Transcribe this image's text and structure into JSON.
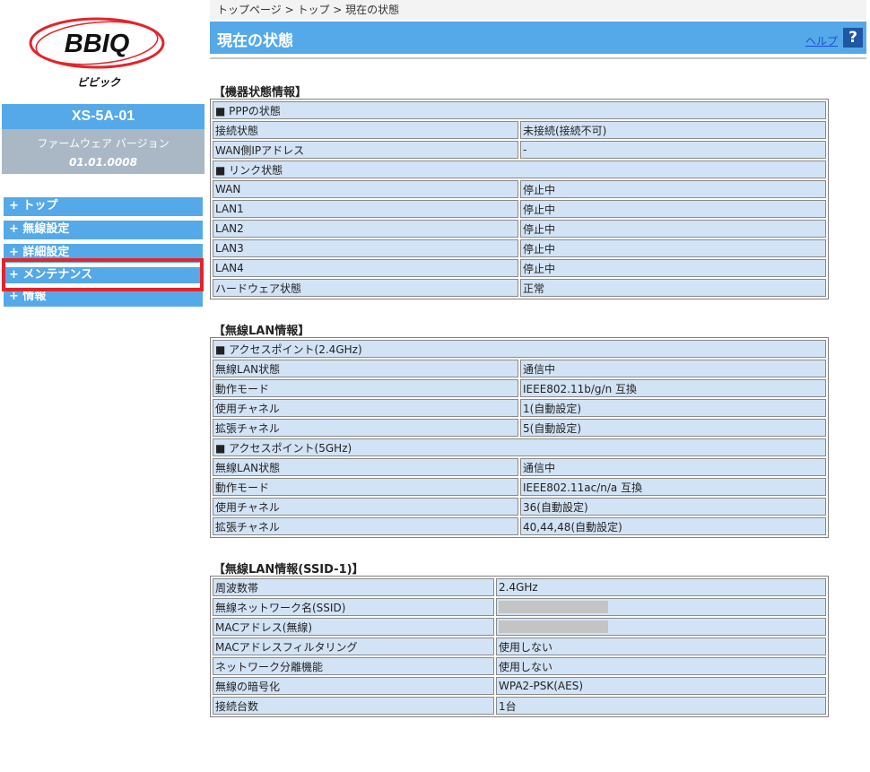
{
  "brand": {
    "logo_text": "BBIQ",
    "logo_sub": "ビビック",
    "logo_color": "#e3242b"
  },
  "device": {
    "model": "XS-5A-01",
    "firmware_label": "ファームウェア バージョン",
    "firmware_version": "01.01.0008"
  },
  "nav": {
    "items": [
      {
        "label": "+ トップ"
      },
      {
        "label": "+ 無線設定"
      },
      {
        "label": "+ 詳細設定"
      },
      {
        "label": "+ メンテナンス"
      },
      {
        "label": "+ 情報"
      }
    ]
  },
  "breadcrumb": "トップページ > トップ > 現在の状態",
  "header": {
    "title": "現在の状態",
    "help_label": "ヘルプ",
    "help_icon": "?"
  },
  "sections": [
    {
      "title": "【機器状態情報】",
      "rows": [
        {
          "type": "group",
          "label": "■ PPPの状態"
        },
        {
          "label": "接続状態",
          "value": "未接続(接続不可)"
        },
        {
          "label": "WAN側IPアドレス",
          "value": "-"
        },
        {
          "type": "group",
          "label": "■ リンク状態"
        },
        {
          "label": "WAN",
          "value": "停止中"
        },
        {
          "label": "LAN1",
          "value": "停止中"
        },
        {
          "label": "LAN2",
          "value": "停止中"
        },
        {
          "label": "LAN3",
          "value": "停止中"
        },
        {
          "label": "LAN4",
          "value": "停止中"
        },
        {
          "label": "ハードウェア状態",
          "value": "正常"
        }
      ]
    },
    {
      "title": "【無線LAN情報】",
      "rows": [
        {
          "type": "group",
          "label": "■ アクセスポイント(2.4GHz)"
        },
        {
          "label": "無線LAN状態",
          "value": "通信中"
        },
        {
          "label": "動作モード",
          "value": "IEEE802.11b/g/n 互換"
        },
        {
          "label": "使用チャネル",
          "value": "1(自動設定)"
        },
        {
          "label": "拡張チャネル",
          "value": "5(自動設定)"
        },
        {
          "type": "group",
          "label": "■ アクセスポイント(5GHz)"
        },
        {
          "label": "無線LAN状態",
          "value": "通信中"
        },
        {
          "label": "動作モード",
          "value": "IEEE802.11ac/n/a 互換"
        },
        {
          "label": "使用チャネル",
          "value": "36(自動設定)"
        },
        {
          "label": "拡張チャネル",
          "value": "40,44,48(自動設定)"
        }
      ]
    },
    {
      "title": "【無線LAN情報(SSID-1)】",
      "rows": [
        {
          "label": "周波数帯",
          "value": "2.4GHz"
        },
        {
          "label": "無線ネットワーク名(SSID)",
          "value": "",
          "masked": true
        },
        {
          "label": "MACアドレス(無線)",
          "value": "",
          "masked": true
        },
        {
          "label": "MACアドレスフィルタリング",
          "value": "使用しない"
        },
        {
          "label": "ネットワーク分離機能",
          "value": "使用しない"
        },
        {
          "label": "無線の暗号化",
          "value": "WPA2-PSK(AES)"
        },
        {
          "label": "接続台数",
          "value": "1台"
        }
      ]
    }
  ],
  "colors": {
    "accent": "#55a9e8",
    "cell": "#d2e3f6",
    "firmware_bg": "#aab8c6",
    "help_bg": "#1f57a6",
    "highlight": "#e3242b"
  }
}
